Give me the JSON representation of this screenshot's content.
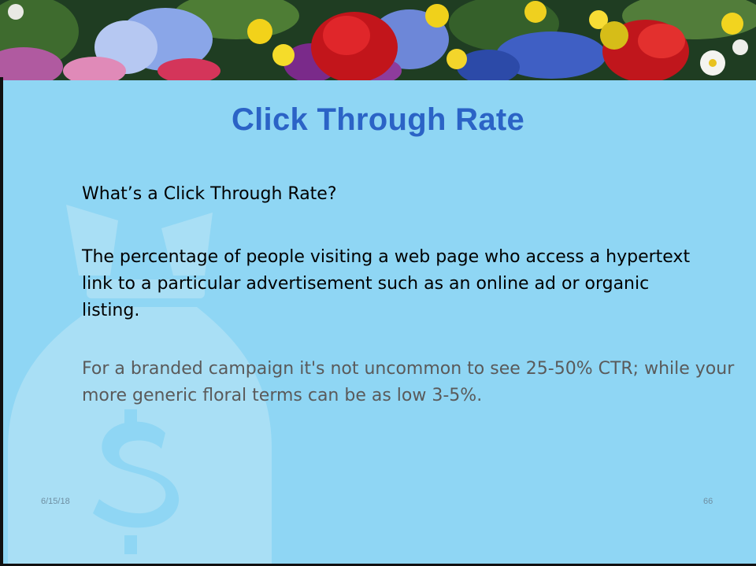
{
  "slide": {
    "title": "Click Through Rate",
    "question": "What’s a Click Through Rate?",
    "definition": "The percentage of people visiting a web page who access a hypertext link to a particular advertisement such as an online ad or organic listing.",
    "example": "For a branded campaign it's not uncommon to see 25-50% CTR; while your more generic floral terms can be as low 3-5%.",
    "footer_date": "6/15/18",
    "page_number": "66"
  },
  "colors": {
    "background": "#8fd6f4",
    "title": "#2b63c6",
    "body_text": "#000000",
    "example_text": "#5a5a5a",
    "watermark": "#a9dff5"
  },
  "icons": {
    "banner": "flower-banner-image",
    "watermark": "money-bag-icon"
  }
}
